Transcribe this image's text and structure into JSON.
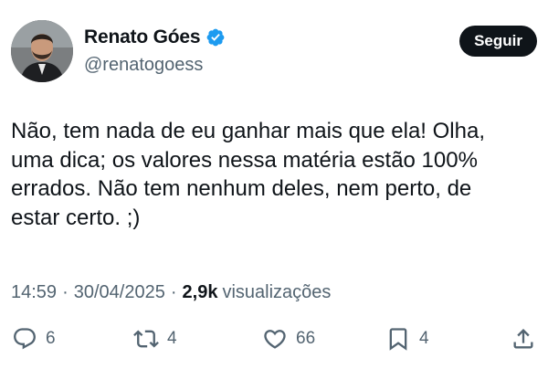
{
  "author": {
    "display_name": "Renato Góes",
    "handle": "@renatogoess",
    "verified_icon": "verified-badge-icon",
    "accent_color": "#1d9bf0"
  },
  "follow_button": {
    "label": "Seguir"
  },
  "tweet": {
    "text": "Não, tem nada de eu ganhar mais que ela! Olha,\numa dica; os valores nessa matéria estão 100%\nerrados. Não tem nenhum deles, nem perto, de\nestar certo. ;)"
  },
  "meta": {
    "time": "14:59",
    "separator": "·",
    "date": "30/04/2025",
    "views_count": "2,9k",
    "views_label": "visualizações"
  },
  "actions": {
    "reply": {
      "icon": "reply-icon",
      "count": "6"
    },
    "retweet": {
      "icon": "retweet-icon",
      "count": "4"
    },
    "like": {
      "icon": "heart-icon",
      "count": "66"
    },
    "bookmark": {
      "icon": "bookmark-icon",
      "count": "4"
    },
    "share": {
      "icon": "share-icon"
    }
  }
}
